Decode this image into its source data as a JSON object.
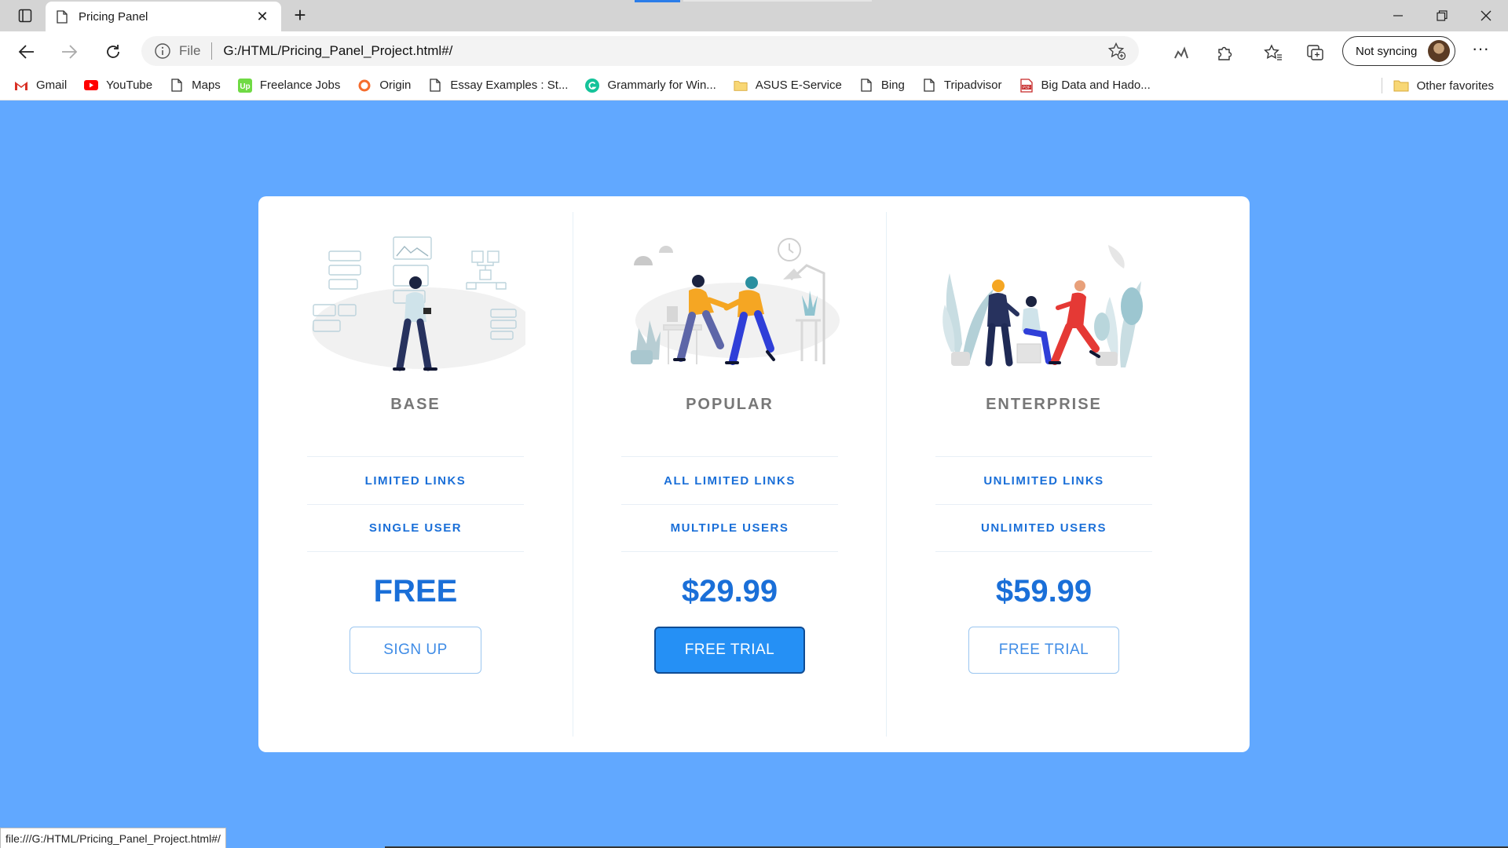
{
  "browser": {
    "tab": {
      "title": "Pricing Panel"
    },
    "address": {
      "scheme_label": "File",
      "url": "G:/HTML/Pricing_Panel_Project.html#/"
    },
    "sync_label": "Not syncing",
    "bookmarks": [
      {
        "label": "Gmail",
        "icon": "gmail-icon"
      },
      {
        "label": "YouTube",
        "icon": "youtube-icon"
      },
      {
        "label": "Maps",
        "icon": "page-icon"
      },
      {
        "label": "Freelance Jobs",
        "icon": "upwork-icon"
      },
      {
        "label": "Origin",
        "icon": "origin-icon"
      },
      {
        "label": "Essay Examples : St...",
        "icon": "page-icon"
      },
      {
        "label": "Grammarly for Win...",
        "icon": "grammarly-icon"
      },
      {
        "label": "ASUS E-Service",
        "icon": "folder-icon"
      },
      {
        "label": "Bing",
        "icon": "page-icon"
      },
      {
        "label": "Tripadvisor",
        "icon": "page-icon"
      },
      {
        "label": "Big Data and Hado...",
        "icon": "pdf-icon"
      }
    ],
    "other_favorites": "Other favorites",
    "status_url": "file:///G:/HTML/Pricing_Panel_Project.html#/"
  },
  "plans": [
    {
      "name": "BASE",
      "features": [
        "LIMITED LINKS",
        "SINGLE USER"
      ],
      "price": "FREE",
      "cta": "SIGN UP"
    },
    {
      "name": "POPULAR",
      "features": [
        "ALL LIMITED LINKS",
        "MULTIPLE USERS"
      ],
      "price": "$29.99",
      "cta": "FREE TRIAL"
    },
    {
      "name": "ENTERPRISE",
      "features": [
        "UNLIMITED LINKS",
        "UNLIMITED USERS"
      ],
      "price": "$59.99",
      "cta": "FREE TRIAL"
    }
  ],
  "colors": {
    "page_bg": "#61a8ff",
    "accent": "#1a6fd8",
    "primary_button": "#2590f5"
  }
}
